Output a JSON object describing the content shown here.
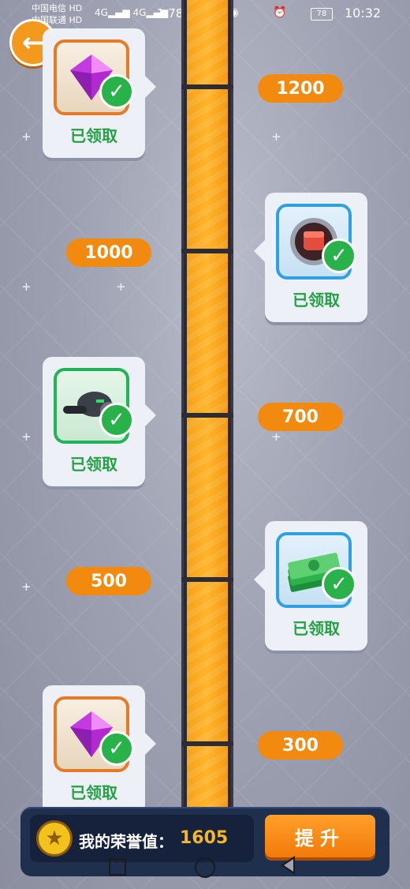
{
  "status_bar": {
    "carrier1": "中国电信",
    "carrier2": "中国联通",
    "hd": "HD",
    "signal": "4G",
    "speed": "1.78K/s",
    "battery": "78",
    "time": "10:32"
  },
  "milestones": [
    "1200",
    "1000",
    "700",
    "500",
    "300"
  ],
  "rewards": [
    {
      "item": "diamond-icon",
      "status": "已领取",
      "frame_color": "#e37b27"
    },
    {
      "item": "fist-token-icon",
      "status": "已领取",
      "frame_color": "#2fa1e0"
    },
    {
      "item": "gas-mask-icon",
      "status": "已领取",
      "frame_color": "#23b357"
    },
    {
      "item": "cash-icon",
      "status": "已领取",
      "frame_color": "#2fa1e0"
    },
    {
      "item": "diamond-icon",
      "status": "已领取",
      "frame_color": "#e37b27"
    }
  ],
  "bottom": {
    "honor_label": "我的荣誉值：",
    "honor_value": "1605",
    "upgrade_label": "提升"
  },
  "colors": {
    "accent": "#f38a10",
    "claimed_green": "#21a343",
    "panel": "#1f2f4e"
  }
}
